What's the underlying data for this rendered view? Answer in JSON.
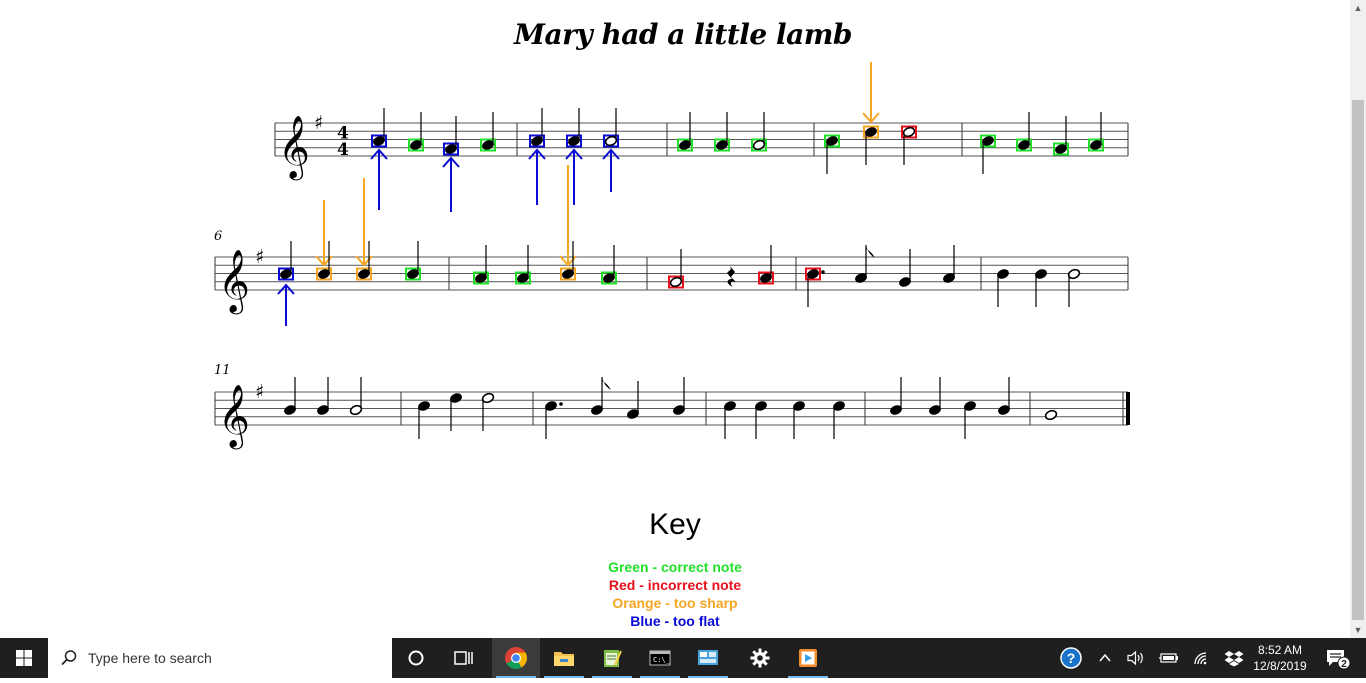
{
  "title": "Mary had a little lamb",
  "measure_numbers": [
    "6",
    "11"
  ],
  "key": {
    "title": "Key",
    "items": [
      {
        "text": "Green - correct note",
        "color": "#22e02a"
      },
      {
        "text": "Red - incorrect note",
        "color": "#e8101a"
      },
      {
        "text": "Orange - too sharp",
        "color": "#f5a623"
      },
      {
        "text": "Blue - too flat",
        "color": "#0a0ad6"
      }
    ]
  },
  "colors": {
    "correct": "#22e02a",
    "incorrect": "#e8101a",
    "sharp": "#f5a623",
    "flat": "#0a0ad6"
  },
  "taskbar": {
    "search_placeholder": "Type here to search",
    "apps": [
      "cortana-icon",
      "task-view-icon",
      "chrome-icon",
      "file-explorer-icon",
      "notepad-icon",
      "terminal-icon",
      "control-panel-icon",
      "settings-icon",
      "media-player-icon"
    ],
    "time": "8:52 AM",
    "date": "12/8/2019",
    "notification_count": "2"
  }
}
